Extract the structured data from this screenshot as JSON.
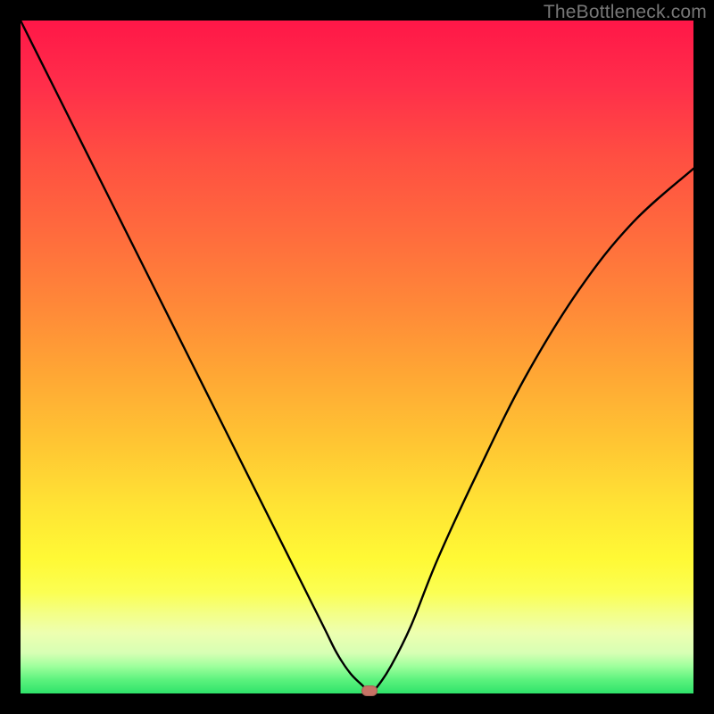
{
  "watermark": "TheBottleneck.com",
  "marker_color": "#c77265",
  "chart_data": {
    "type": "line",
    "title": "",
    "xlabel": "",
    "ylabel": "",
    "xlim": [
      0,
      100
    ],
    "ylim": [
      0,
      100
    ],
    "series": [
      {
        "name": "bottleneck-curve",
        "x": [
          0,
          5,
          10,
          15,
          20,
          25,
          30,
          35,
          40,
          45,
          47,
          49,
          51,
          51.8,
          53,
          55,
          58,
          62,
          68,
          75,
          83,
          91,
          100
        ],
        "y": [
          100,
          90,
          80,
          70,
          60,
          50,
          40,
          30,
          20,
          10,
          6,
          3,
          1,
          0,
          1,
          4,
          10,
          20,
          33,
          47,
          60,
          70,
          78
        ]
      }
    ],
    "marker": {
      "x": 51.8,
      "y": 0
    },
    "gradient_stops": [
      {
        "pos": 0,
        "color": "#ff1748"
      },
      {
        "pos": 50,
        "color": "#ff9c36"
      },
      {
        "pos": 80,
        "color": "#fff935"
      },
      {
        "pos": 100,
        "color": "#2fe26a"
      }
    ]
  }
}
